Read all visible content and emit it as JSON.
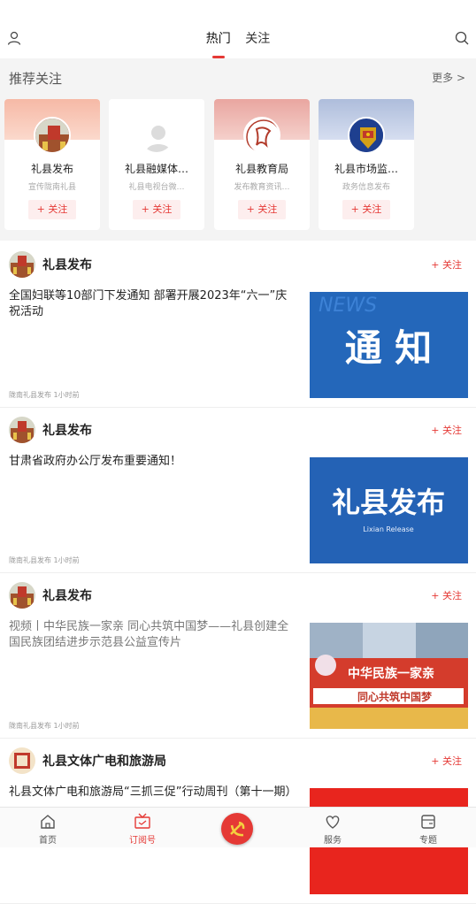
{
  "tabs": [
    "热门",
    "关注"
  ],
  "recommend": {
    "title": "推荐关注",
    "more": "更多 >",
    "cards": [
      {
        "name": "礼县发布",
        "desc": "宣传陇南礼县",
        "follow": "+ 关注"
      },
      {
        "name": "礼县融媒体…",
        "desc": "礼县电视台微…",
        "follow": "+ 关注"
      },
      {
        "name": "礼县教育局",
        "desc": "发布教育资讯…",
        "follow": "+ 关注"
      },
      {
        "name": "礼县市场监…",
        "desc": "政务信息发布",
        "follow": "+ 关注"
      }
    ]
  },
  "feed": [
    {
      "name": "礼县发布",
      "follow": "+ 关注",
      "title": "全国妇联等10部门下发通知 部署开展2023年“六一”庆祝活动",
      "meta": "陇南礼县发布  1小时前",
      "img_text": "通 知",
      "img_sub": "NEWS"
    },
    {
      "name": "礼县发布",
      "follow": "+ 关注",
      "title": "甘肃省政府办公厅发布重要通知！",
      "meta": "陇南礼县发布  1小时前",
      "img_text": "礼县发布",
      "img_sub": "Lixian  Release"
    },
    {
      "name": "礼县发布",
      "follow": "+ 关注",
      "title": "视频丨中华民族一家亲 同心共筑中国梦——礼县创建全国民族团结进步示范县公益宣传片",
      "meta": "陇南礼县发布  1小时前",
      "img_text": "中华民族一家亲",
      "img_sub": "同心共筑中国梦"
    },
    {
      "name": "礼县文体广电和旅游局",
      "follow": "+ 关注",
      "title": "礼县文体广电和旅游局“三抓三促”行动周刊（第十一期）",
      "meta": "",
      "img_text": "",
      "img_sub": ""
    }
  ],
  "bottom_nav": [
    {
      "label": "首页",
      "icon": "home-icon"
    },
    {
      "label": "订阅号",
      "icon": "tv-icon"
    },
    {
      "label": "",
      "icon": "party-emblem-icon"
    },
    {
      "label": "服务",
      "icon": "heart-icon"
    },
    {
      "label": "专题",
      "icon": "wallet-icon"
    }
  ],
  "colors": {
    "accent": "#e53935",
    "bg_gray": "#f4f4f4",
    "news_blue": "#1f5fb0"
  }
}
